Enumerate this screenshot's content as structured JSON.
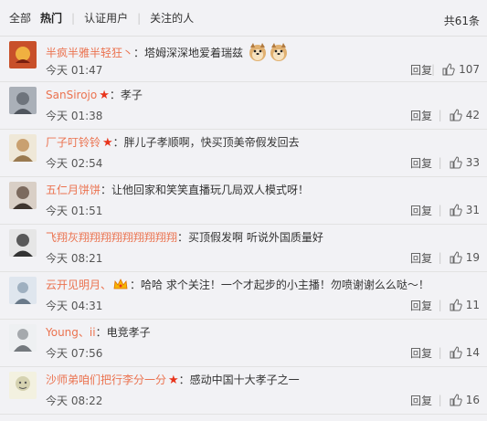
{
  "tabs": [
    {
      "label": "全部",
      "active": false
    },
    {
      "label": "热门",
      "active": true
    },
    {
      "label": "认证用户",
      "active": false
    },
    {
      "label": "关注的人",
      "active": false
    }
  ],
  "total": "共61条",
  "reply_label": "回复",
  "comments": [
    {
      "user": "半疯半雅半轻狂丶",
      "text": "：塔姆深深地爱着瑞兹",
      "time": "今天 01:47",
      "likes": "107",
      "avatar_color": "#c8502a",
      "emojis": 2
    },
    {
      "user": "SanSirojo",
      "star": "★",
      "text": "：孝子",
      "time": "今天 01:38",
      "likes": "42",
      "avatar_color": "#8a8f96"
    },
    {
      "user": "厂子叮铃铃",
      "star": "★",
      "text": "：胖儿子孝顺啊，快买顶美帝假发回去",
      "time": "今天 02:54",
      "likes": "33",
      "avatar_color": "#b9a88a"
    },
    {
      "user": "五仁月饼饼",
      "text": "：让他回家和笑笑直播玩几局双人模式呀！",
      "time": "今天 01:51",
      "likes": "31",
      "avatar_color": "#7c6a5e"
    },
    {
      "user": "飞翔灰翔翔翔翔翔翔翔翔翔",
      "text": "：买顶假发啊 听说外国质量好",
      "time": "今天 08:21",
      "likes": "19",
      "avatar_color": "#5a5a5a"
    },
    {
      "user": "云开见明月、",
      "badge": true,
      "text": "：哈哈 求个关注！一个才起步的小主播！勿喷谢谢么么哒～！",
      "time": "今天 04:31",
      "likes": "11",
      "avatar_color": "#9fb0c0"
    },
    {
      "user": "Young、ii",
      "text": "：电竞孝子",
      "time": "今天 07:56",
      "likes": "14",
      "avatar_color": "#a5a9ad"
    },
    {
      "user": "沙师弟咱们把行李分一分",
      "star": "★",
      "text": "：感动中国十大孝子之一",
      "time": "今天 08:22",
      "likes": "16",
      "avatar_color": "#d5d2b0"
    }
  ]
}
